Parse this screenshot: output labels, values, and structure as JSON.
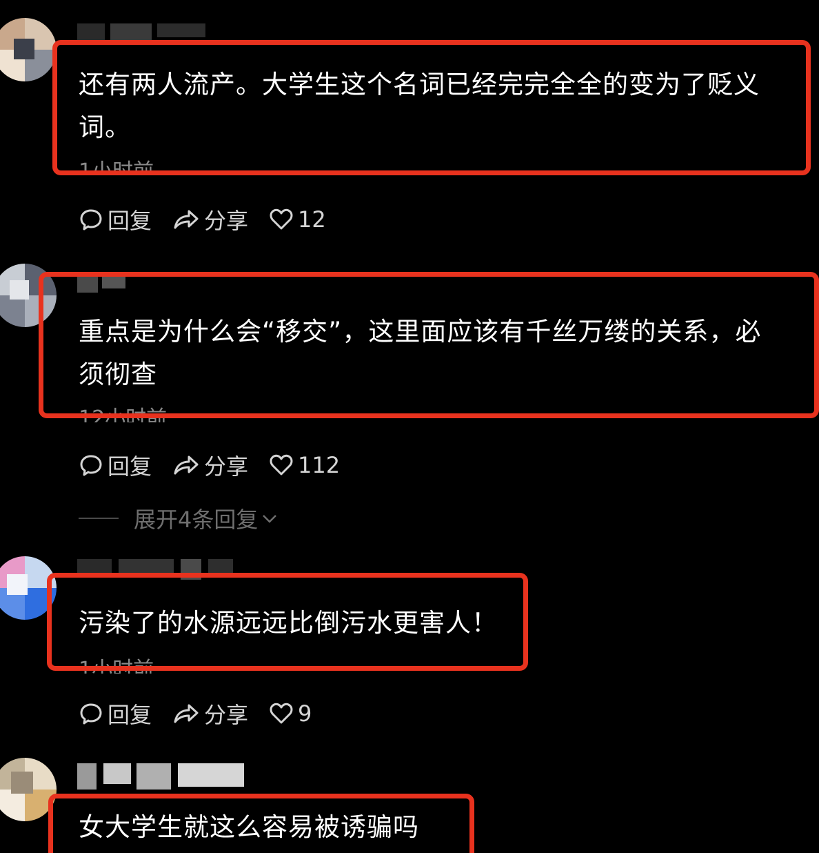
{
  "comments": [
    {
      "text_line1": "还有两人流产。大学生这个名词已经完完全全的变为了贬义",
      "text_line2": "词。",
      "time": "1小时前",
      "reply_label": "回复",
      "share_label": "分享",
      "likes": "12"
    },
    {
      "text_line1": "重点是为什么会“移交”，这里面应该有千丝万缕的关系，必",
      "text_line2": "须彻查",
      "time": "12小时前",
      "reply_label": "回复",
      "share_label": "分享",
      "likes": "112",
      "expand_replies": "展开4条回复"
    },
    {
      "text_line1": "污染了的水源远远比倒污水更害人！",
      "time": "1小时前",
      "reply_label": "回复",
      "share_label": "分享",
      "likes": "9"
    },
    {
      "text_line1": "女大学生就这么容易被诱骗吗"
    }
  ],
  "colors": {
    "background": "#000000",
    "highlight": "#e8321e",
    "text": "#ffffff",
    "muted": "#8a8a8a",
    "action": "#d4d4d4"
  },
  "icons": [
    "comment-bubble-icon",
    "share-arrow-icon",
    "heart-icon",
    "chevron-down-icon"
  ]
}
